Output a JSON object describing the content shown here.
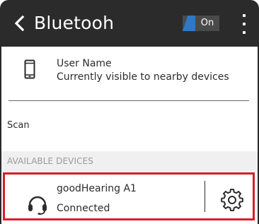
{
  "appbar": {
    "title": "Bluetooh",
    "toggle_label": "On",
    "toggle_on": true,
    "back_icon": "chevron-left-icon",
    "menu_icon": "more-vertical-icon"
  },
  "user": {
    "name": "User Name",
    "status": "Currently visible to nearby devices",
    "icon": "smartphone-icon"
  },
  "scan_label": "Scan",
  "available_header": "AVAILABLE DEVICES",
  "devices": [
    {
      "name": "goodHearing A1",
      "status": "Connected",
      "icon": "headset-icon",
      "settings_icon": "gear-icon"
    }
  ],
  "colors": {
    "appbar_bg": "#2b2b2b",
    "toggle_accent": "#2e78c8",
    "toggle_bg": "#4a4a4a",
    "highlight_border": "#d41f2a",
    "section_bg": "#f0f0f0",
    "section_text": "#9a9a9a"
  }
}
